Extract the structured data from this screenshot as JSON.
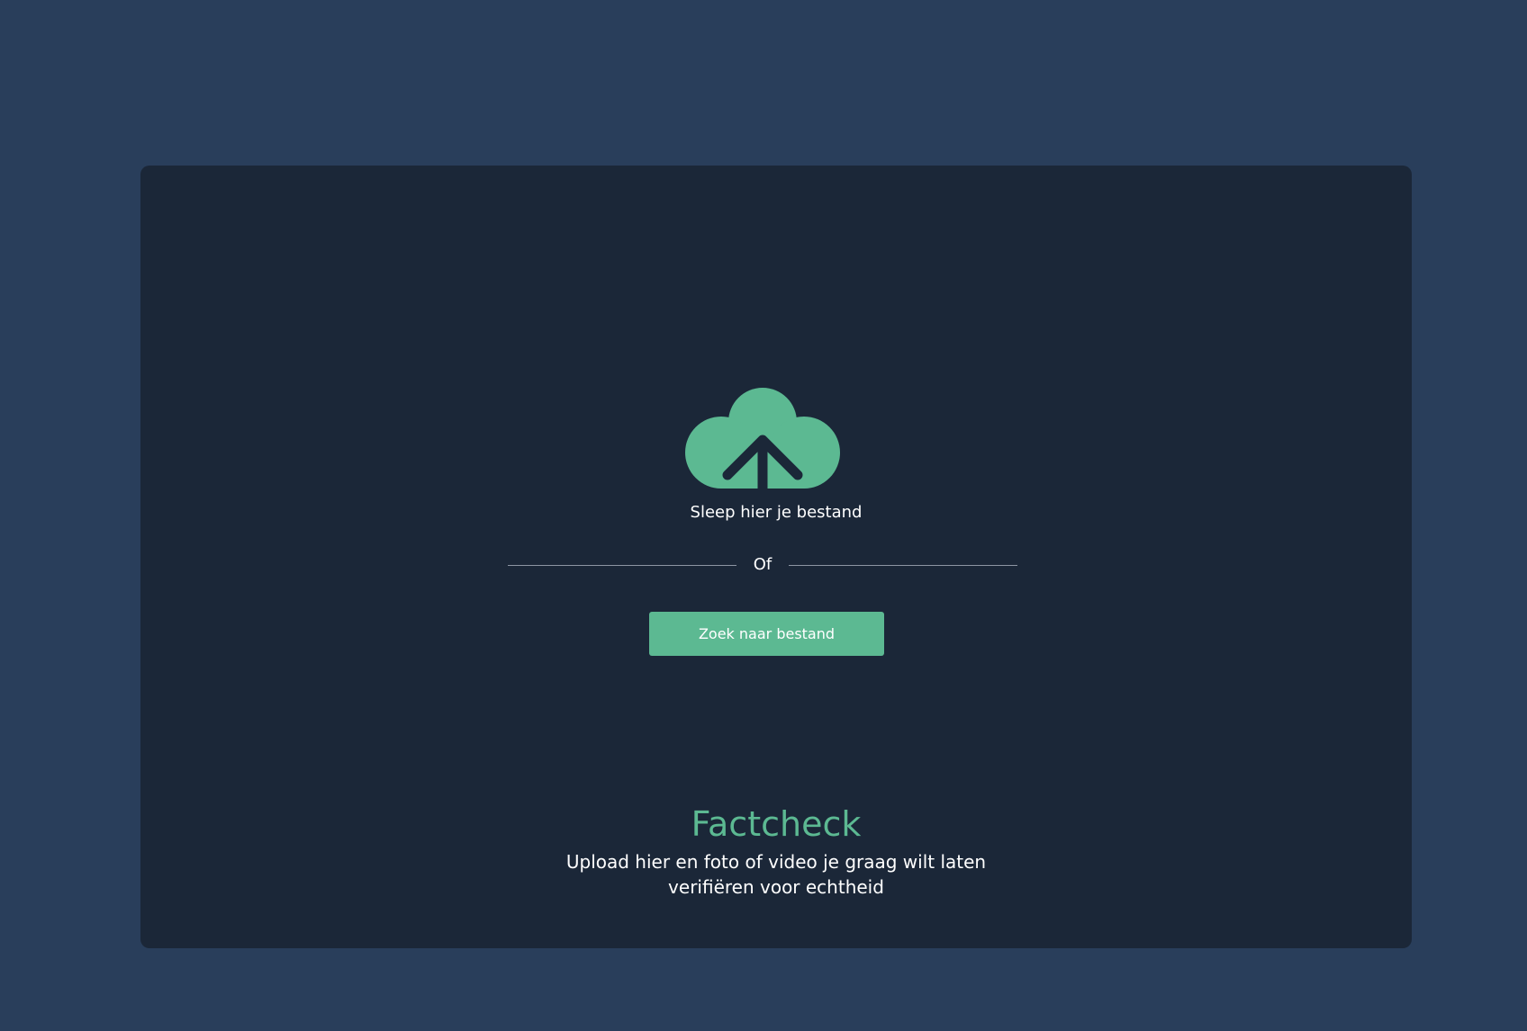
{
  "colors": {
    "background": "#293e5b",
    "panel": "#1b2738",
    "accent": "#5cb992",
    "text": "#ffffff",
    "divider": "#8d96a3"
  },
  "upload": {
    "icon": "cloud-upload-icon",
    "drop_label": "Sleep hier je bestand",
    "divider_label": "Of",
    "browse_button_label": "Zoek naar bestand"
  },
  "info": {
    "title": "Factcheck",
    "description": "Upload hier en foto of video je graag wilt laten verifiëren voor echtheid"
  }
}
